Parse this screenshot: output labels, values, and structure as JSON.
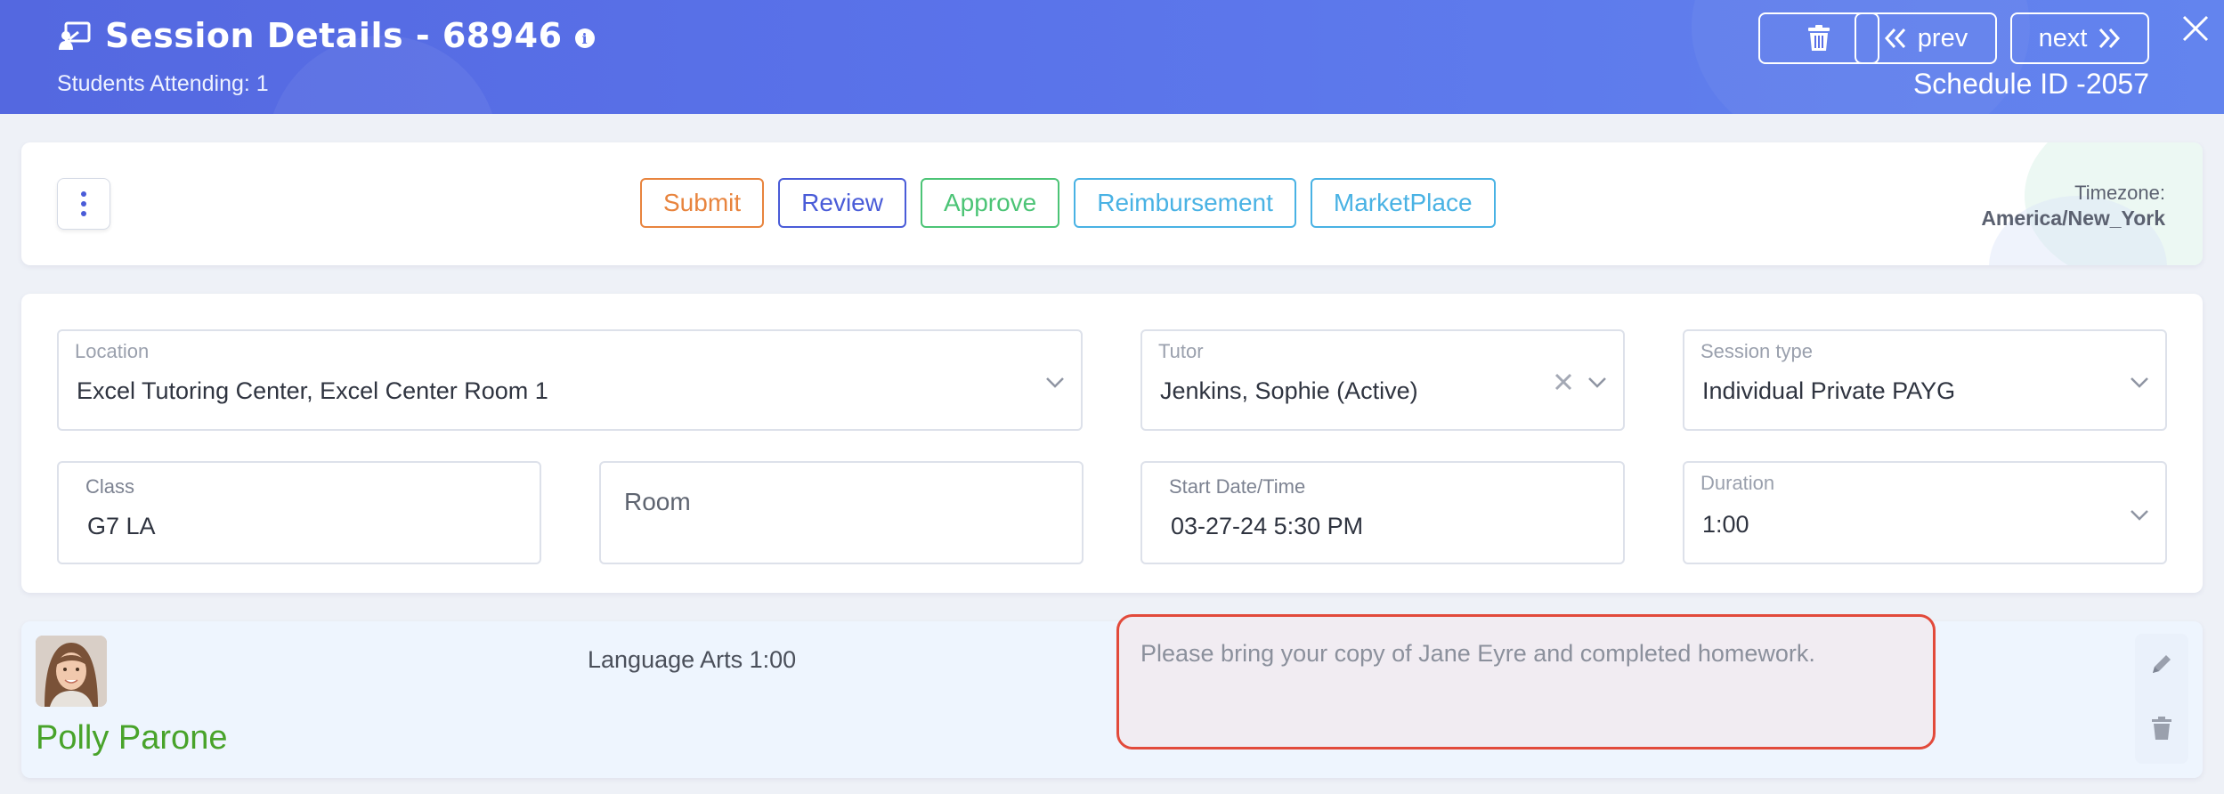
{
  "header": {
    "title": "Session Details - 68946",
    "info_icon": "i",
    "attending": "Students Attending: 1",
    "prev_label": "prev",
    "next_label": "next",
    "schedule_id": "Schedule ID -2057"
  },
  "actions": {
    "submit": "Submit",
    "review": "Review",
    "approve": "Approve",
    "reimbursement": "Reimbursement",
    "marketplace": "MarketPlace"
  },
  "timezone": {
    "label": "Timezone:",
    "value": "America/New_York"
  },
  "form": {
    "location": {
      "label": "Location",
      "value": "Excel Tutoring Center, Excel Center Room 1"
    },
    "tutor": {
      "label": "Tutor",
      "value": "Jenkins, Sophie (Active)"
    },
    "session_type": {
      "label": "Session type",
      "value": "Individual Private PAYG"
    },
    "class": {
      "label": "Class",
      "value": "G7 LA"
    },
    "room": {
      "label": "Room",
      "value": ""
    },
    "start": {
      "label": "Start Date/Time",
      "value": "03-27-24 5:30 PM"
    },
    "duration": {
      "label": "Duration",
      "value": "1:00"
    }
  },
  "student": {
    "name": "Polly Parone",
    "subject": "Language Arts 1:00",
    "note": "Please bring your copy of Jane Eyre and completed homework."
  },
  "colors": {
    "header_gradient_start": "#5468e0",
    "header_gradient_end": "#6384ee",
    "submit": "#e8843e",
    "review": "#4a5cd8",
    "approve": "#4cc476",
    "reimbursement": "#49b2e4",
    "marketplace": "#49b2e4",
    "student_name": "#48a32a",
    "note_border": "#e24a3b"
  },
  "icons": {
    "title": "teacher-board-icon",
    "info": "info-icon",
    "trash": "trash-icon",
    "prev": "double-chevron-left-icon",
    "next": "double-chevron-right-icon",
    "close": "close-icon",
    "kebab": "kebab-menu-icon",
    "chevron": "chevron-down-icon",
    "clear": "clear-icon",
    "edit": "pencil-icon",
    "delete": "trash-icon"
  }
}
